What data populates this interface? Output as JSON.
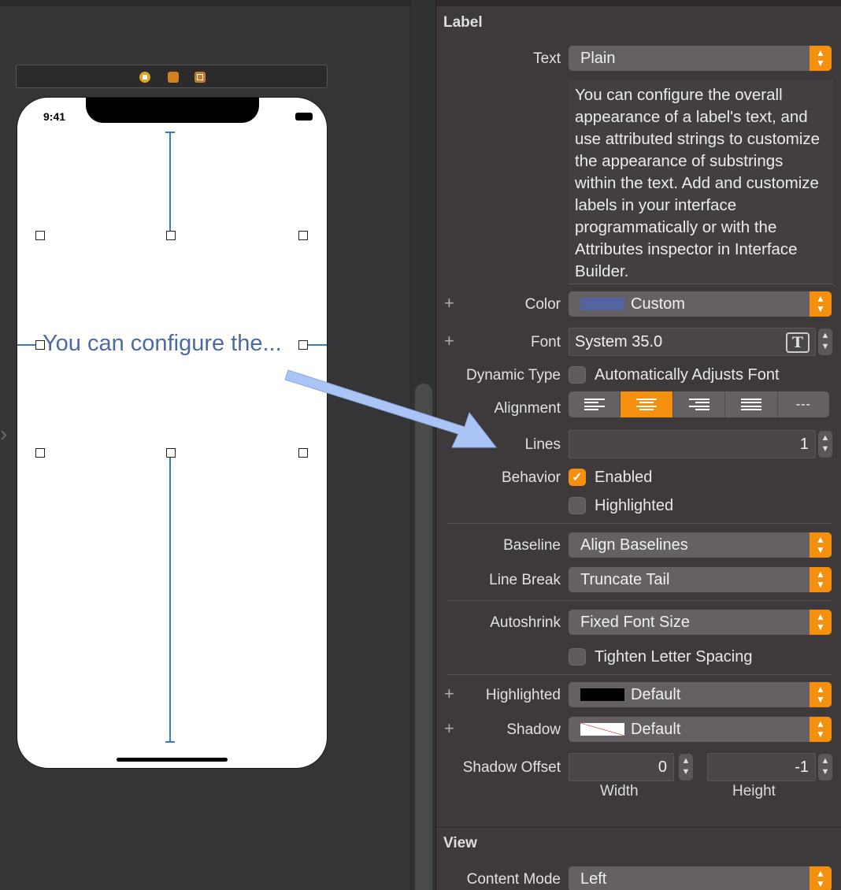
{
  "canvas": {
    "status_time": "9:41",
    "label_preview": "You can configure the...",
    "nav_chevron": "chevron-right-icon"
  },
  "inspector": {
    "label_section": {
      "title": "Label",
      "text": {
        "label": "Text",
        "value": "Plain"
      },
      "text_content": "You can configure the overall appearance of a label's text, and use attributed strings to customize the appearance of substrings within the text. Add and customize labels in your interface programmatically or with the Attributes inspector in Interface Builder.",
      "color": {
        "label": "Color",
        "value": "Custom",
        "swatch": "#5464a0"
      },
      "font": {
        "label": "Font",
        "value": "System 35.0"
      },
      "dynamic_type": {
        "label": "Dynamic Type",
        "option": "Automatically Adjusts Font",
        "checked": false
      },
      "alignment": {
        "label": "Alignment",
        "options": [
          "left",
          "center",
          "right",
          "justified",
          "natural"
        ],
        "selected": "center",
        "natural_glyph": "---"
      },
      "lines": {
        "label": "Lines",
        "value": "1"
      },
      "behavior": {
        "label": "Behavior",
        "enabled": "Enabled",
        "enabled_checked": true,
        "highlighted": "Highlighted",
        "highlighted_checked": false
      },
      "baseline": {
        "label": "Baseline",
        "value": "Align Baselines"
      },
      "line_break": {
        "label": "Line Break",
        "value": "Truncate Tail"
      },
      "autoshrink": {
        "label": "Autoshrink",
        "value": "Fixed Font Size"
      },
      "tighten": {
        "option": "Tighten Letter Spacing",
        "checked": false
      },
      "highlighted_color": {
        "label": "Highlighted",
        "value": "Default",
        "swatch": "#000000"
      },
      "shadow": {
        "label": "Shadow",
        "value": "Default"
      },
      "shadow_offset": {
        "label": "Shadow Offset",
        "width": "0",
        "height": "-1",
        "width_caption": "Width",
        "height_caption": "Height"
      }
    },
    "view_section": {
      "title": "View",
      "content_mode": {
        "label": "Content Mode",
        "value": "Left"
      }
    }
  },
  "colors": {
    "accent": "#f5900f",
    "constraint": "#3a7cc2",
    "arrow": "#a9c4f5"
  }
}
